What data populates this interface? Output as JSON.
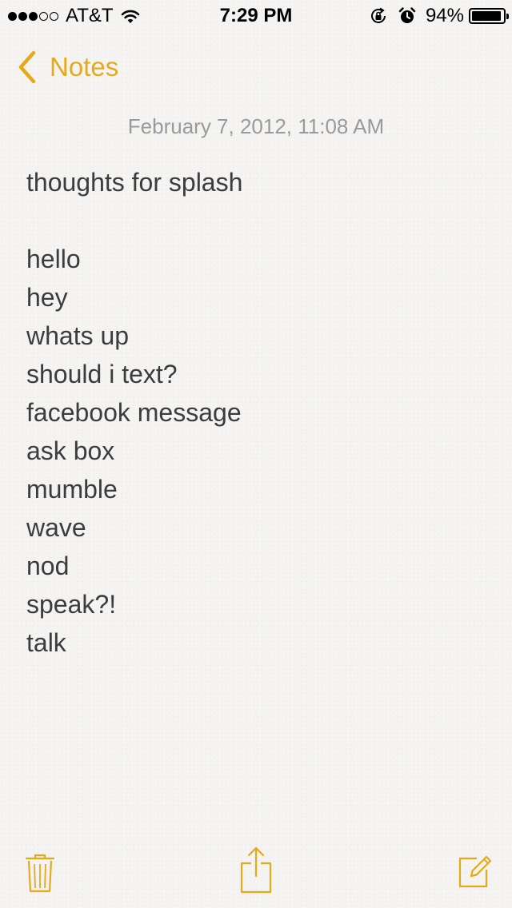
{
  "status_bar": {
    "signal_bars_filled": 3,
    "signal_bars_total": 5,
    "carrier": "AT&T",
    "time": "7:29 PM",
    "battery_percent": "94%",
    "battery_level": 0.94,
    "icons": [
      "wifi-icon",
      "lock-rotation-icon",
      "alarm-icon",
      "battery-icon"
    ]
  },
  "nav": {
    "back_label": "Notes",
    "accent_color": "#e6a91a"
  },
  "note": {
    "date": "February 7, 2012, 11:08 AM",
    "lines": [
      "thoughts for splash",
      "",
      "hello",
      "hey",
      "whats up",
      "should i text?",
      "facebook message",
      "ask box",
      "mumble",
      "wave",
      "nod",
      "speak?!",
      "talk"
    ]
  },
  "toolbar": {
    "icons": [
      "trash-icon",
      "share-icon",
      "compose-icon"
    ]
  }
}
